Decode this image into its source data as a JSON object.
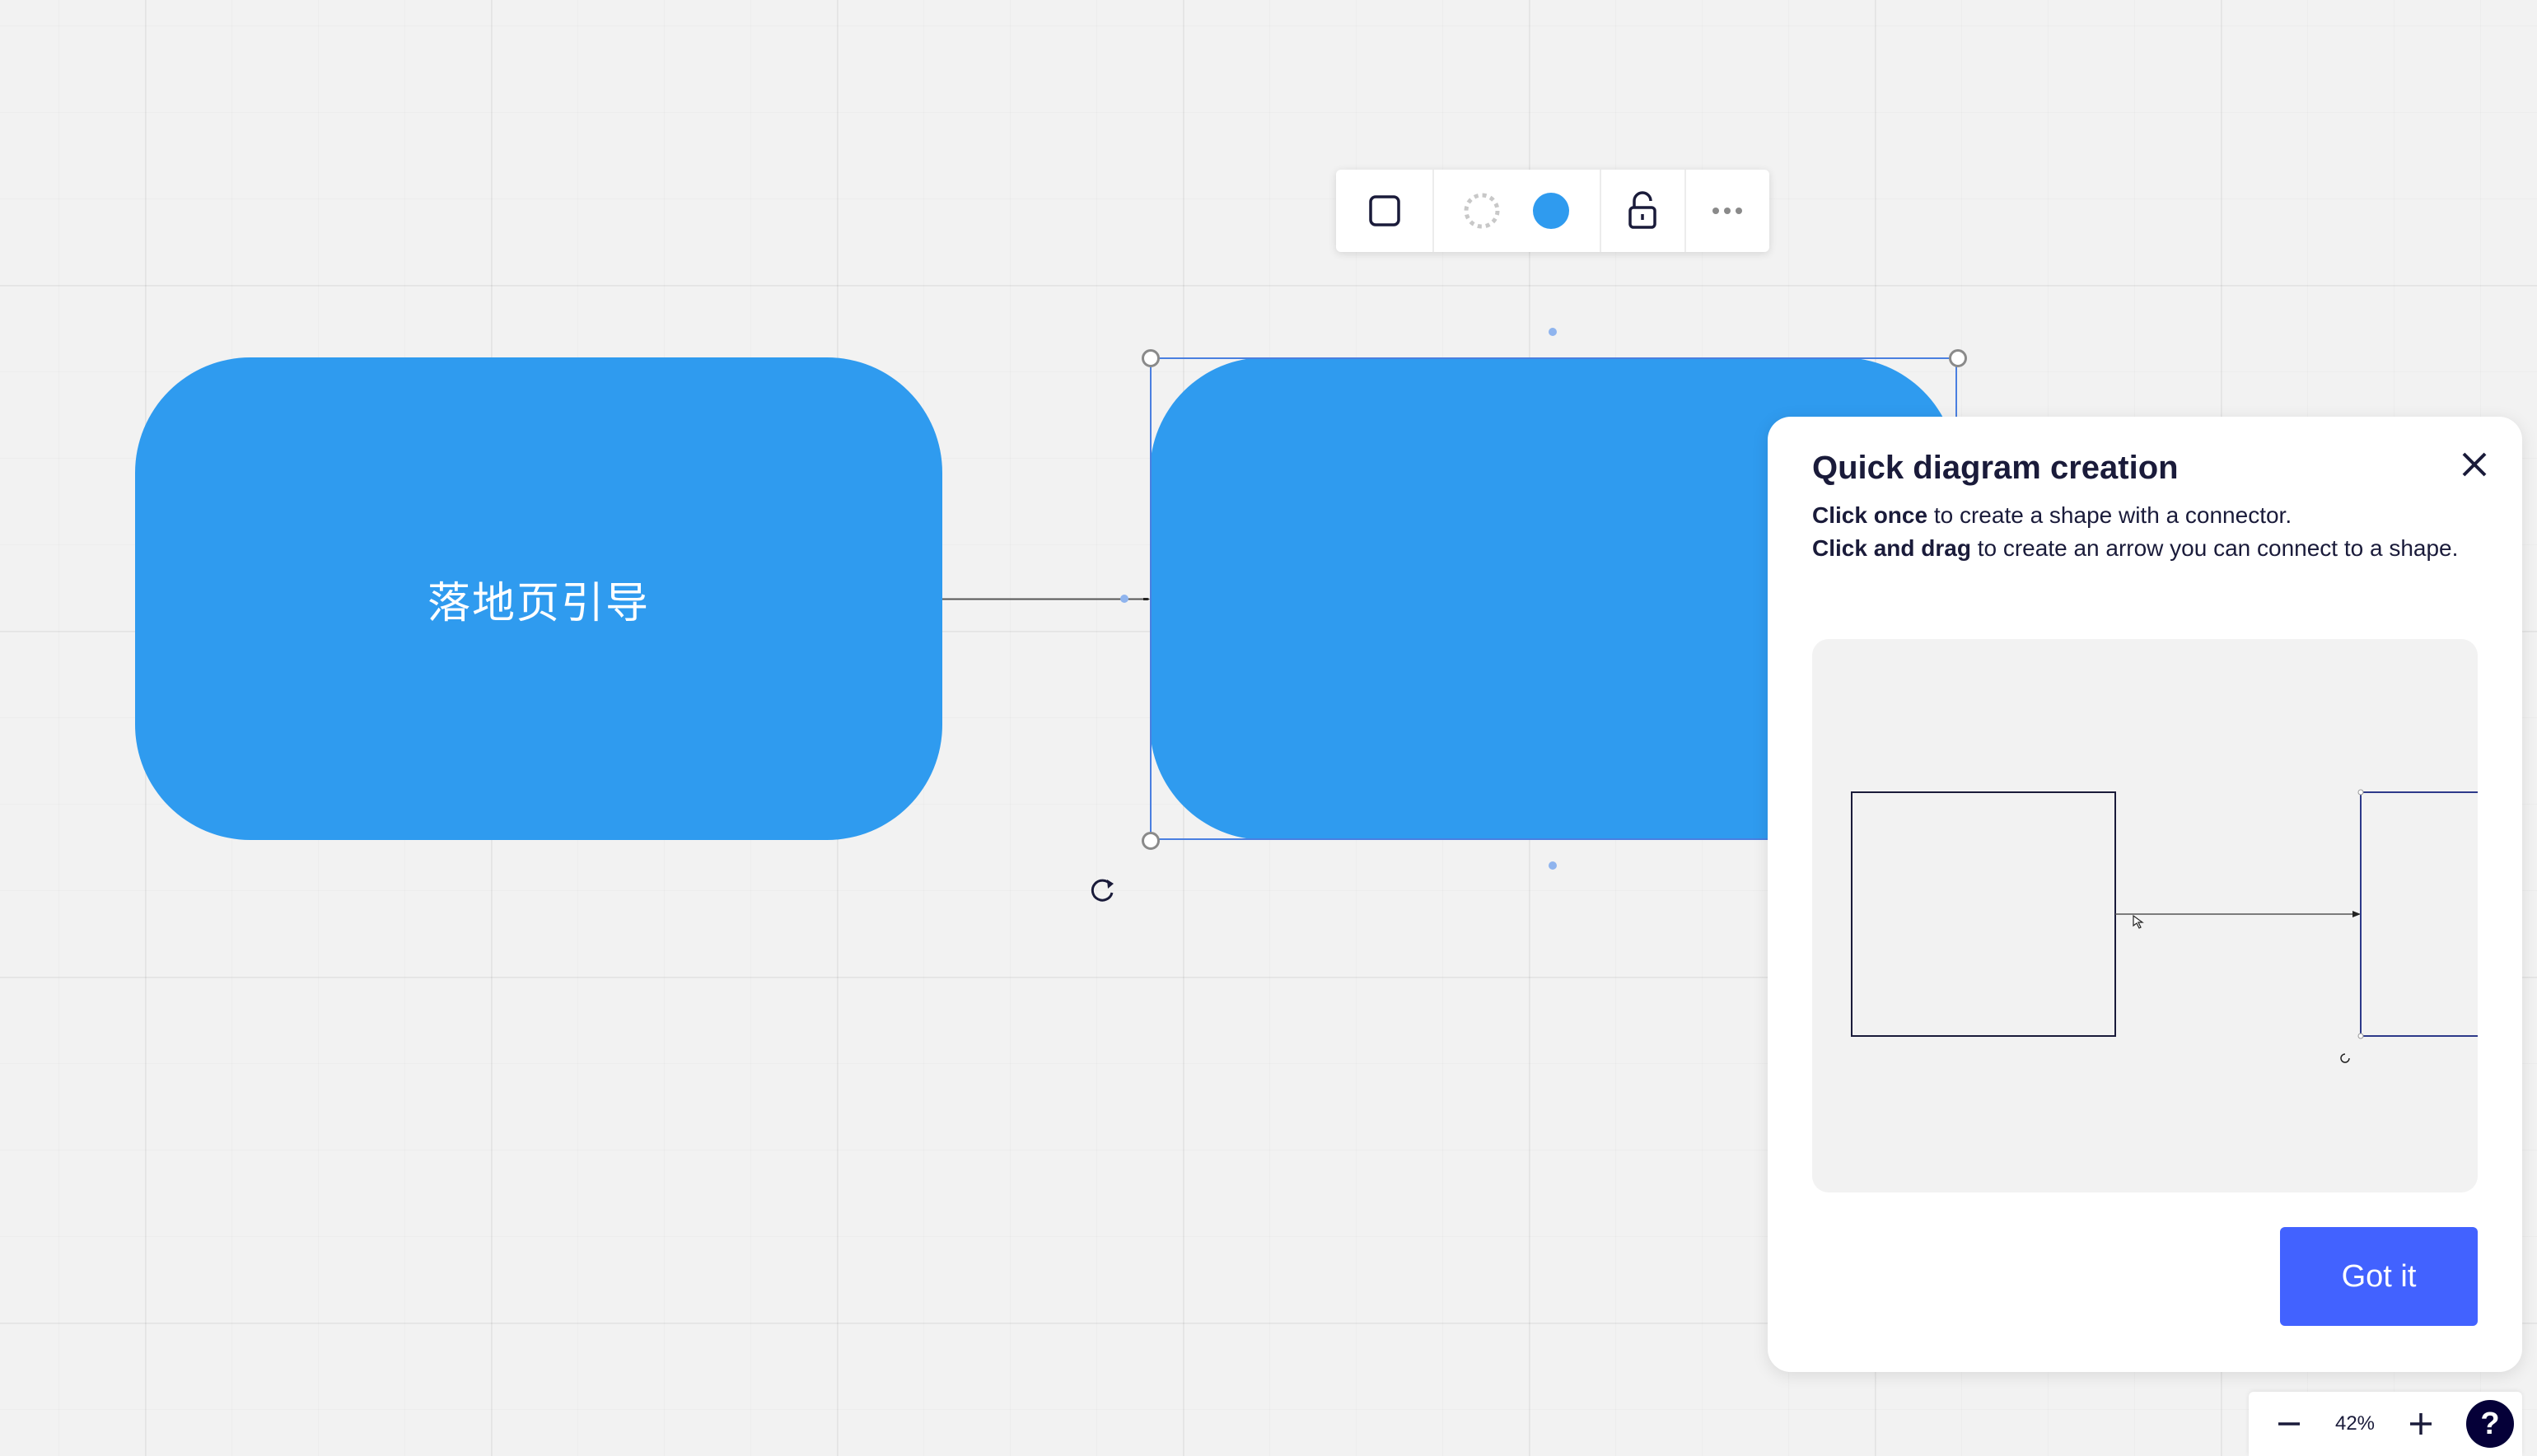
{
  "board": {
    "shapes": [
      {
        "label": "落地页引导",
        "fill": "#2f9bef"
      },
      {
        "label": "",
        "fill": "#2f9bef"
      }
    ],
    "selection_color": "#4a7fe0"
  },
  "toolbar": {
    "items": [
      {
        "icon": "shape-icon"
      },
      {
        "icon": "border-style-icon"
      },
      {
        "icon": "fill-color-icon",
        "color": "#2f9bef"
      },
      {
        "icon": "unlock-icon"
      },
      {
        "icon": "more-icon"
      }
    ]
  },
  "tip": {
    "title": "Quick diagram creation",
    "line1_bold": "Click once",
    "line1_rest": " to create a shape with a connector.",
    "line2_bold": "Click and drag",
    "line2_rest": " to create an arrow you can connect to a shape.",
    "button": "Got it",
    "close_icon": "close-icon"
  },
  "zoom": {
    "level": "42%",
    "minus_icon": "minus-icon",
    "plus_icon": "plus-icon",
    "help_label": "?"
  },
  "colors": {
    "accent": "#4262ff",
    "shape_blue": "#2f9bef",
    "text_dark": "#1a1b3a",
    "canvas": "#f2f2f2"
  }
}
